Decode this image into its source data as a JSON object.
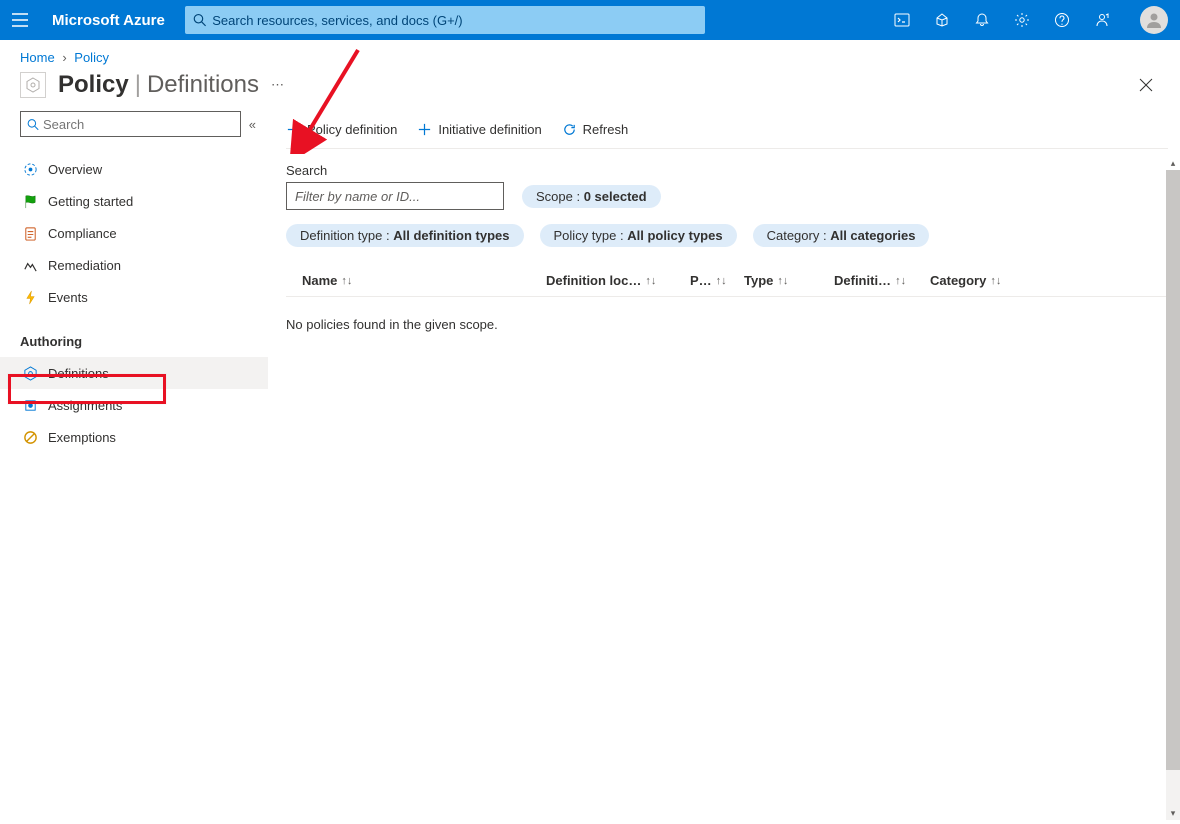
{
  "header": {
    "brand": "Microsoft Azure",
    "search_placeholder": "Search resources, services, and docs (G+/)"
  },
  "breadcrumb": {
    "home": "Home",
    "policy": "Policy"
  },
  "page": {
    "title_main": "Policy",
    "title_sub": "Definitions"
  },
  "sidebar": {
    "search_placeholder": "Search",
    "items": {
      "overview": "Overview",
      "getting_started": "Getting started",
      "compliance": "Compliance",
      "remediation": "Remediation",
      "events": "Events"
    },
    "section_authoring": "Authoring",
    "authoring": {
      "definitions": "Definitions",
      "assignments": "Assignments",
      "exemptions": "Exemptions"
    }
  },
  "toolbar": {
    "policy_definition": "Policy definition",
    "initiative_definition": "Initiative definition",
    "refresh": "Refresh"
  },
  "filters": {
    "search_label": "Search",
    "filter_placeholder": "Filter by name or ID...",
    "scope_label": "Scope : ",
    "scope_value": "0 selected",
    "deftype_label": "Definition type : ",
    "deftype_value": "All definition types",
    "poltype_label": "Policy type : ",
    "poltype_value": "All policy types",
    "category_label": "Category : ",
    "category_value": "All categories"
  },
  "table": {
    "columns": {
      "name": "Name",
      "definition_location": "Definition loc…",
      "p": "P…",
      "type": "Type",
      "definition": "Definiti…",
      "category": "Category"
    },
    "rows": [],
    "empty_message": "No policies found in the given scope."
  }
}
